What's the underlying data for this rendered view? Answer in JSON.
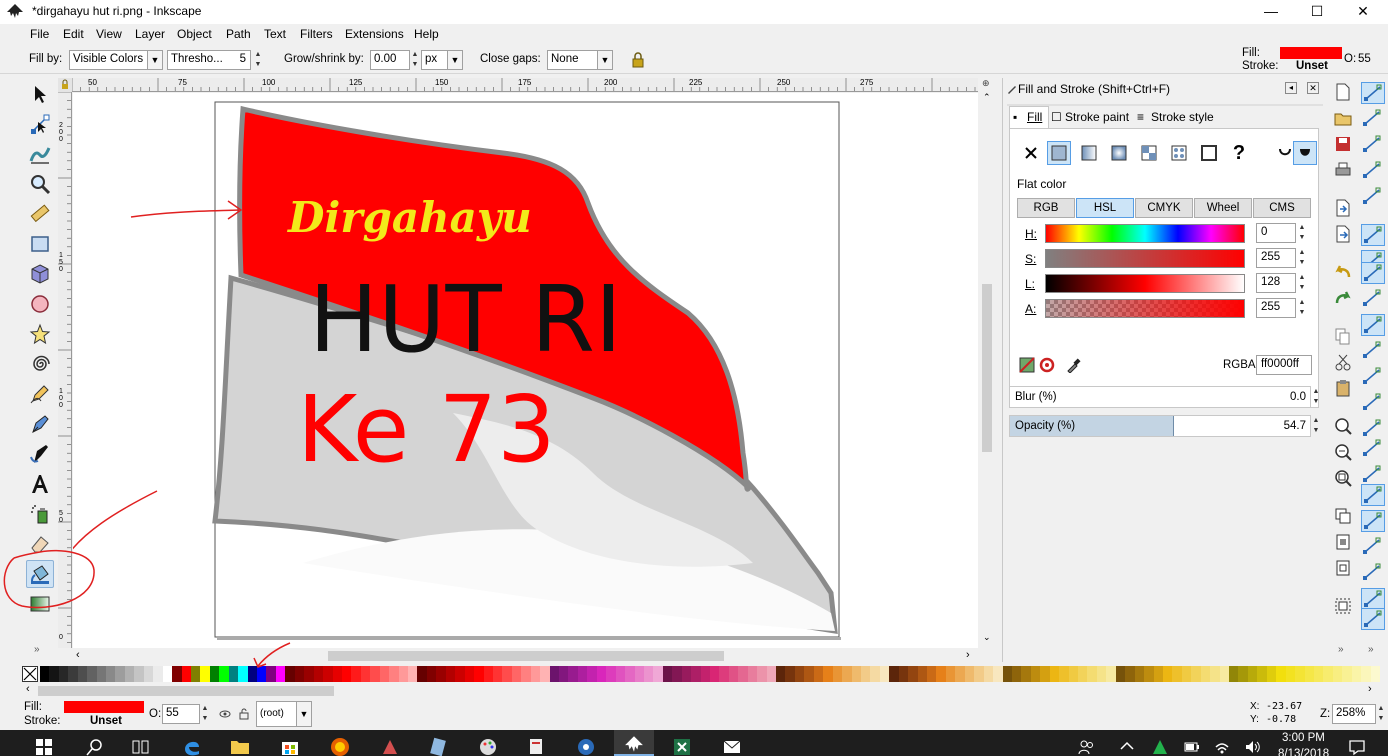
{
  "window": {
    "title": "*dirgahayu hut ri.png - Inkscape",
    "controls": {
      "minimize": "—",
      "maximize": "☐",
      "close": "✕"
    }
  },
  "menu": [
    "File",
    "Edit",
    "View",
    "Layer",
    "Object",
    "Path",
    "Text",
    "Filters",
    "Extensions",
    "Help"
  ],
  "tool_controls": {
    "fill_by_label": "Fill by:",
    "fill_by_value": "Visible Colors",
    "threshold_label": "Thresho...",
    "threshold_value": "5",
    "grow_label": "Grow/shrink by:",
    "grow_value": "0.00",
    "unit": "px",
    "close_gaps_label": "Close gaps:",
    "close_gaps_value": "None"
  },
  "style_indicator": {
    "fill_label": "Fill:",
    "stroke_label": "Stroke:",
    "stroke_value": "Unset",
    "opacity_label": "O:",
    "opacity_value": "55",
    "fill_color": "#ff0000"
  },
  "ruler": {
    "h_labels": [
      "50",
      "75",
      "100",
      "125",
      "150",
      "175",
      "200",
      "225",
      "250",
      "275"
    ],
    "v_labels": [
      "200",
      "150",
      "100",
      "50",
      "0"
    ]
  },
  "canvas": {
    "word_dirgahayu": "Dirgahayu",
    "word_hut": "HUT RI",
    "word_ke": "Ke 73",
    "flag_red": "#ff0000",
    "dirgahayu_color": "#f2ea1a"
  },
  "panel": {
    "title": "Fill and Stroke (Shift+Ctrl+F)",
    "tabs": [
      "Fill",
      "Stroke paint",
      "Stroke style"
    ],
    "unknown_glyph": "?",
    "flat_color_label": "Flat color",
    "modes": [
      "RGB",
      "HSL",
      "CMYK",
      "Wheel",
      "CMS"
    ],
    "selected_mode": "HSL",
    "channels": [
      {
        "label": "H:",
        "value": "0"
      },
      {
        "label": "S:",
        "value": "255"
      },
      {
        "label": "L:",
        "value": "128"
      },
      {
        "label": "A:",
        "value": "255"
      }
    ],
    "rgba_label": "RGBA:",
    "rgba_value": "ff0000ff",
    "blur_label": "Blur (%)",
    "blur_value": "0.0",
    "opacity_label": "Opacity (%)",
    "opacity_value": "54.7",
    "opacity_fraction": 0.547
  },
  "status": {
    "fill_label": "Fill:",
    "stroke_label": "Stroke:",
    "stroke_value": "Unset",
    "opacity_label": "O:",
    "opacity_value": "55",
    "layer": "(root)",
    "x_label": "X:",
    "x_value": "-23.67",
    "y_label": "Y:",
    "y_value": "-0.78",
    "zoom_label": "Z:",
    "zoom_value": "258%"
  },
  "taskbar": {
    "time": "3:00 PM",
    "date": "8/13/2018"
  }
}
